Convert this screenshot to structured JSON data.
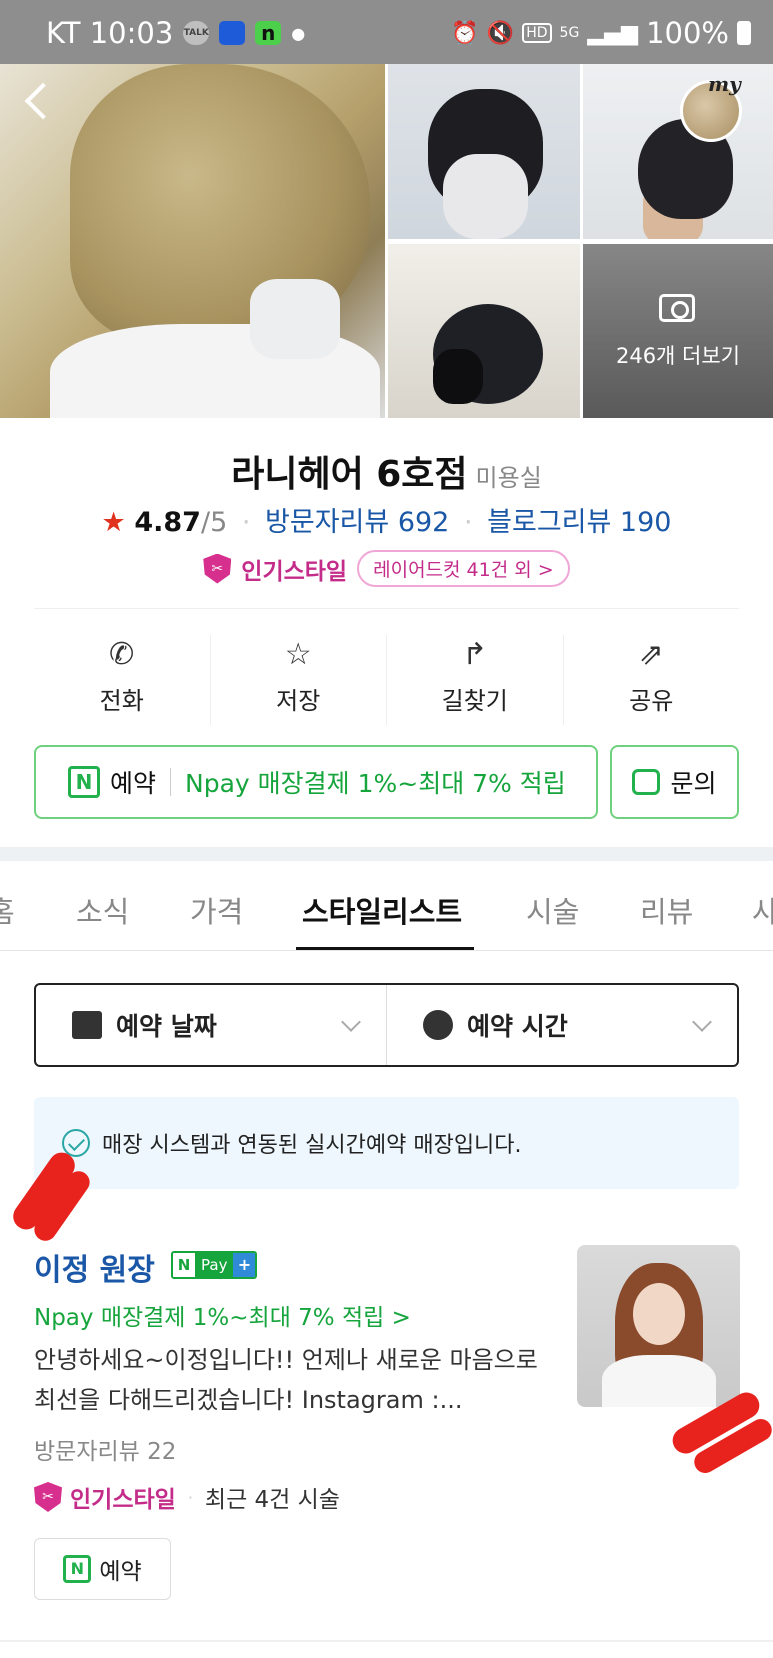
{
  "status_bar": {
    "carrier_time": "KT 10:03",
    "talk_label": "TALK",
    "n_app": "n",
    "signal": "5G",
    "hd": "HD",
    "battery": "100%"
  },
  "gallery": {
    "more_label": "246개 더보기",
    "my_label": "my"
  },
  "shop": {
    "name": "라니헤어 6호점",
    "category": "미용실",
    "rating": "4.87",
    "rating_max": "/5",
    "visitor_reviews": "방문자리뷰 692",
    "blog_reviews": "블로그리뷰 190",
    "popular_label": "인기스타일",
    "popular_chip": "레이어드컷 41건 외 >"
  },
  "actions": [
    {
      "label": "전화",
      "icon": "phone-icon"
    },
    {
      "label": "저장",
      "icon": "star-outline-icon"
    },
    {
      "label": "길찾기",
      "icon": "directions-icon"
    },
    {
      "label": "공유",
      "icon": "share-icon"
    }
  ],
  "reserve": {
    "label": "예약",
    "npay": "Npay 매장결제 1%~최대 7% 적립",
    "inquiry": "문의"
  },
  "tabs": [
    "홈",
    "소식",
    "가격",
    "스타일리스트",
    "시술",
    "리뷰",
    "사"
  ],
  "active_tab": "스타일리스트",
  "filter": {
    "date_label": "예약 날짜",
    "time_label": "예약 시간"
  },
  "notice": "매장 시스템과 연동된 실시간예약 매장입니다.",
  "stylist": {
    "name": "이정 원장",
    "badge_n": "N",
    "badge_pay": "Pay",
    "badge_plus": "+",
    "npay": "Npay 매장결제 1%~최대 7% 적립 >",
    "description": "안녕하세요~이정입니다!! 언제나 새로운 마음으로 최선을 다해드리겠습니다! Instagram :...",
    "reviews": "방문자리뷰 22",
    "popular_label": "인기스타일",
    "recent": "최근 4건 시술",
    "reserve_label": "예약"
  },
  "colors": {
    "link_blue": "#1a57a6",
    "naver_green": "#16a53c",
    "popular_pink": "#c42c8a",
    "star_red": "#e0301e"
  }
}
